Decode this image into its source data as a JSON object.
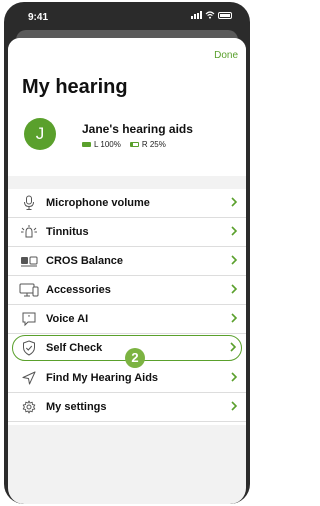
{
  "status_bar": {
    "time": "9:41"
  },
  "header": {
    "done_label": "Done",
    "title": "My hearing"
  },
  "device": {
    "avatar_letter": "J",
    "name": "Jane's hearing aids",
    "left_battery": "L 100%",
    "right_battery": "R 25%",
    "left_battery_level": 1.0,
    "right_battery_level": 0.25
  },
  "menu": {
    "items": [
      {
        "label": "Microphone volume",
        "icon": "microphone-icon"
      },
      {
        "label": "Tinnitus",
        "icon": "tinnitus-icon"
      },
      {
        "label": "CROS Balance",
        "icon": "cros-balance-icon"
      },
      {
        "label": "Accessories",
        "icon": "accessories-icon"
      },
      {
        "label": "Voice AI",
        "icon": "voice-ai-icon"
      },
      {
        "label": "Self Check",
        "icon": "shield-check-icon",
        "selected": true
      },
      {
        "label": "Find My Hearing Aids",
        "icon": "location-arrow-icon"
      },
      {
        "label": "My settings",
        "icon": "gear-icon"
      }
    ]
  },
  "step_badge": "2",
  "colors": {
    "accent": "#5aa02c",
    "badge": "#7cb342"
  }
}
